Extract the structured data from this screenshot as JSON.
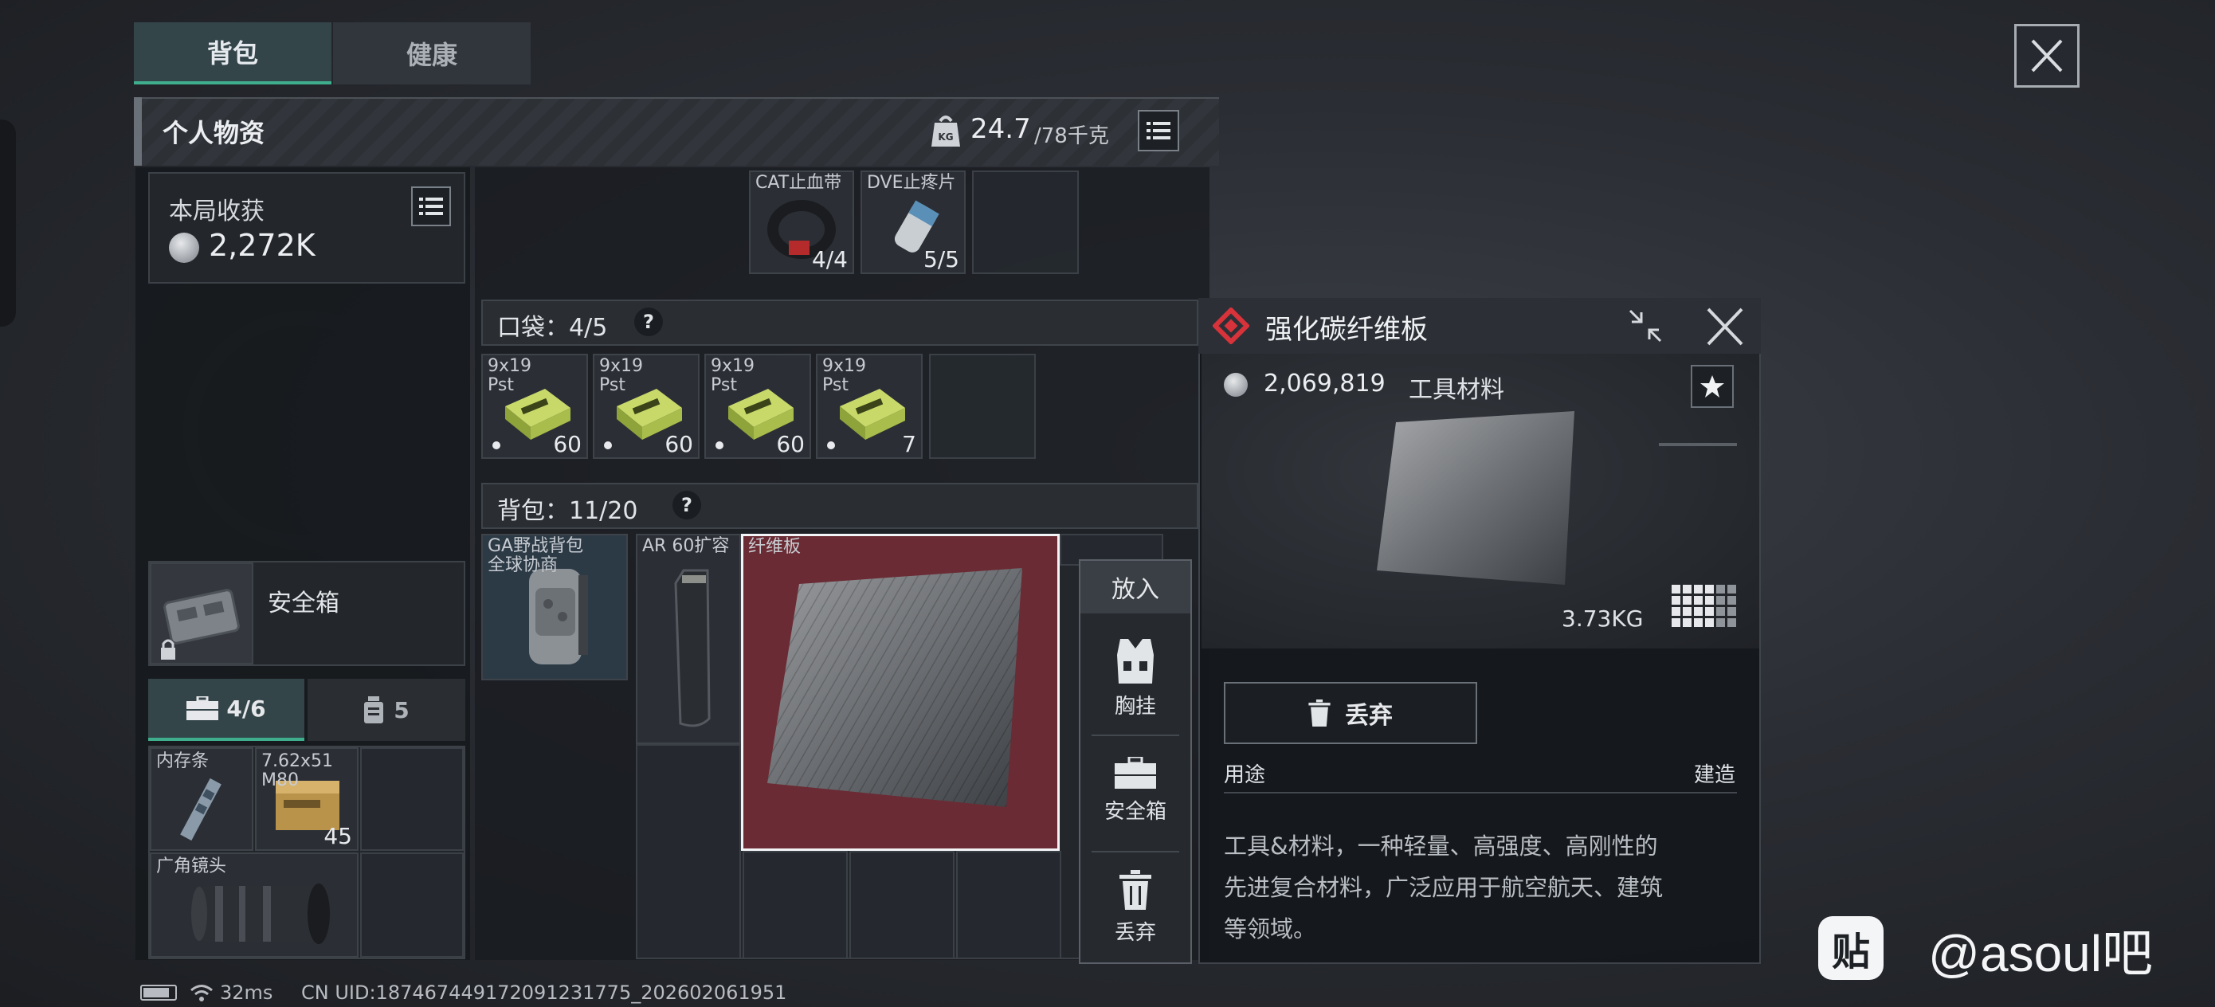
{
  "tabs": [
    {
      "label": "背包",
      "active": true
    },
    {
      "label": "健康",
      "active": false
    }
  ],
  "header": {
    "title": "个人物资",
    "weight_current": "24.7",
    "weight_max": "/78千克",
    "weight_icon": "KG"
  },
  "earnings": {
    "label": "本局收获",
    "value": "2,272K"
  },
  "safe_box": {
    "label": "安全箱"
  },
  "storage_tabs": [
    {
      "label": "4/6",
      "icon": "toolbox-icon",
      "active": true
    },
    {
      "label": "5",
      "icon": "canister-icon",
      "active": false
    }
  ],
  "safe_items": [
    {
      "name": "内存条",
      "count": ""
    },
    {
      "name": "7.62x51\nM80",
      "count": "45"
    },
    {
      "name": "广角镜头",
      "count": ""
    }
  ],
  "top_items": [
    {
      "name": "CAT止血带",
      "count": "4/4"
    },
    {
      "name": "DVE止疼片",
      "count": "5/5"
    }
  ],
  "pocket": {
    "label": "口袋：4/5",
    "help": "?",
    "items": [
      {
        "name": "9x19\nPst",
        "count": "60"
      },
      {
        "name": "9x19\nPst",
        "count": "60"
      },
      {
        "name": "9x19\nPst",
        "count": "60"
      },
      {
        "name": "9x19\nPst",
        "count": "7"
      }
    ]
  },
  "backpack": {
    "label": "背包：11/20",
    "help": "?",
    "items": [
      {
        "name": "GA野战背包\n全球协商"
      },
      {
        "name": "AR 60扩容"
      },
      {
        "name": "纤维板"
      }
    ]
  },
  "actions": {
    "header": "放入",
    "items": [
      {
        "label": "胸挂",
        "icon": "vest-icon"
      },
      {
        "label": "安全箱",
        "icon": "toolbox-icon"
      },
      {
        "label": "丢弃",
        "icon": "trash-icon"
      }
    ]
  },
  "detail": {
    "title": "强化碳纤维板",
    "price": "2,069,819",
    "category": "工具材料",
    "weight": "3.73KG",
    "discard_label": "丢弃",
    "usage_label": "用途",
    "usage_value": "建造",
    "description_lines": [
      "工具&材料，一种轻量、高强度、高刚性的",
      "先进复合材料，广泛应用于航空航天、建筑",
      "等领域。"
    ]
  },
  "status": {
    "ping": "32ms",
    "uid": "CN UID:1874674491720912317​75_202602061951"
  },
  "watermark": {
    "icon_text": "贴",
    "text": "@asoul吧"
  },
  "colors": {
    "accent_green": "#3fae8c",
    "rarity_red": "#d8323a",
    "selected_bg": "#6a2b34"
  }
}
